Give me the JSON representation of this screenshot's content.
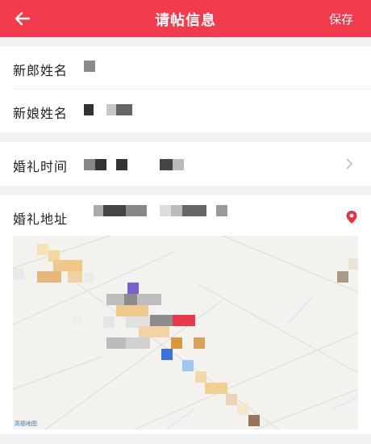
{
  "header": {
    "title": "请帖信息",
    "save_label": "保存",
    "back_icon": "arrow-left-icon",
    "bg_color": "#f23b4c"
  },
  "form": {
    "groom_label": "新郎姓名",
    "bride_label": "新娘姓名",
    "time_label": "婚礼时间",
    "address_label": "婚礼地址"
  },
  "map": {
    "logo_text": "高德地图",
    "pin_icon": "location-pin-icon",
    "pin_color": "#e8323f"
  }
}
